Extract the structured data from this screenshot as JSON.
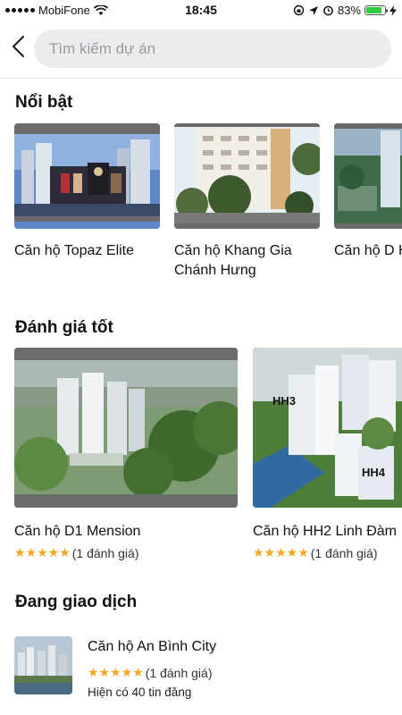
{
  "status_bar": {
    "carrier": "MobiFone",
    "time": "18:45",
    "battery": "83%",
    "battery_level": 0.83
  },
  "search": {
    "placeholder": "Tìm kiếm dự án"
  },
  "featured": {
    "title": "Nổi bật",
    "items": [
      {
        "name": "Căn hộ Topaz Elite"
      },
      {
        "name": "Căn hộ Khang Gia Chánh Hưng"
      },
      {
        "name": "Căn hộ D H"
      }
    ]
  },
  "top_rated": {
    "title": "Đánh giá tốt",
    "items": [
      {
        "name": "Căn hộ D1 Mension",
        "stars": "★★★★★",
        "reviews": "(1 đánh giá)"
      },
      {
        "name": "Căn hộ HH2 Linh Đàm",
        "stars": "★★★★★",
        "reviews": "(1 đánh giá)"
      }
    ]
  },
  "trading": {
    "title": "Đang giao dịch",
    "items": [
      {
        "name": "Căn hộ An Bình City",
        "stars": "★★★★★",
        "reviews": "(1 đánh giá)",
        "listings": "Hiện có 40 tin đăng"
      }
    ]
  },
  "image_labels": {
    "hh3": "HH3",
    "hh4": "HH4"
  },
  "colors": {
    "accent_star": "#f5a623",
    "search_bg": "#ececee",
    "battery_green": "#2ecc40"
  }
}
